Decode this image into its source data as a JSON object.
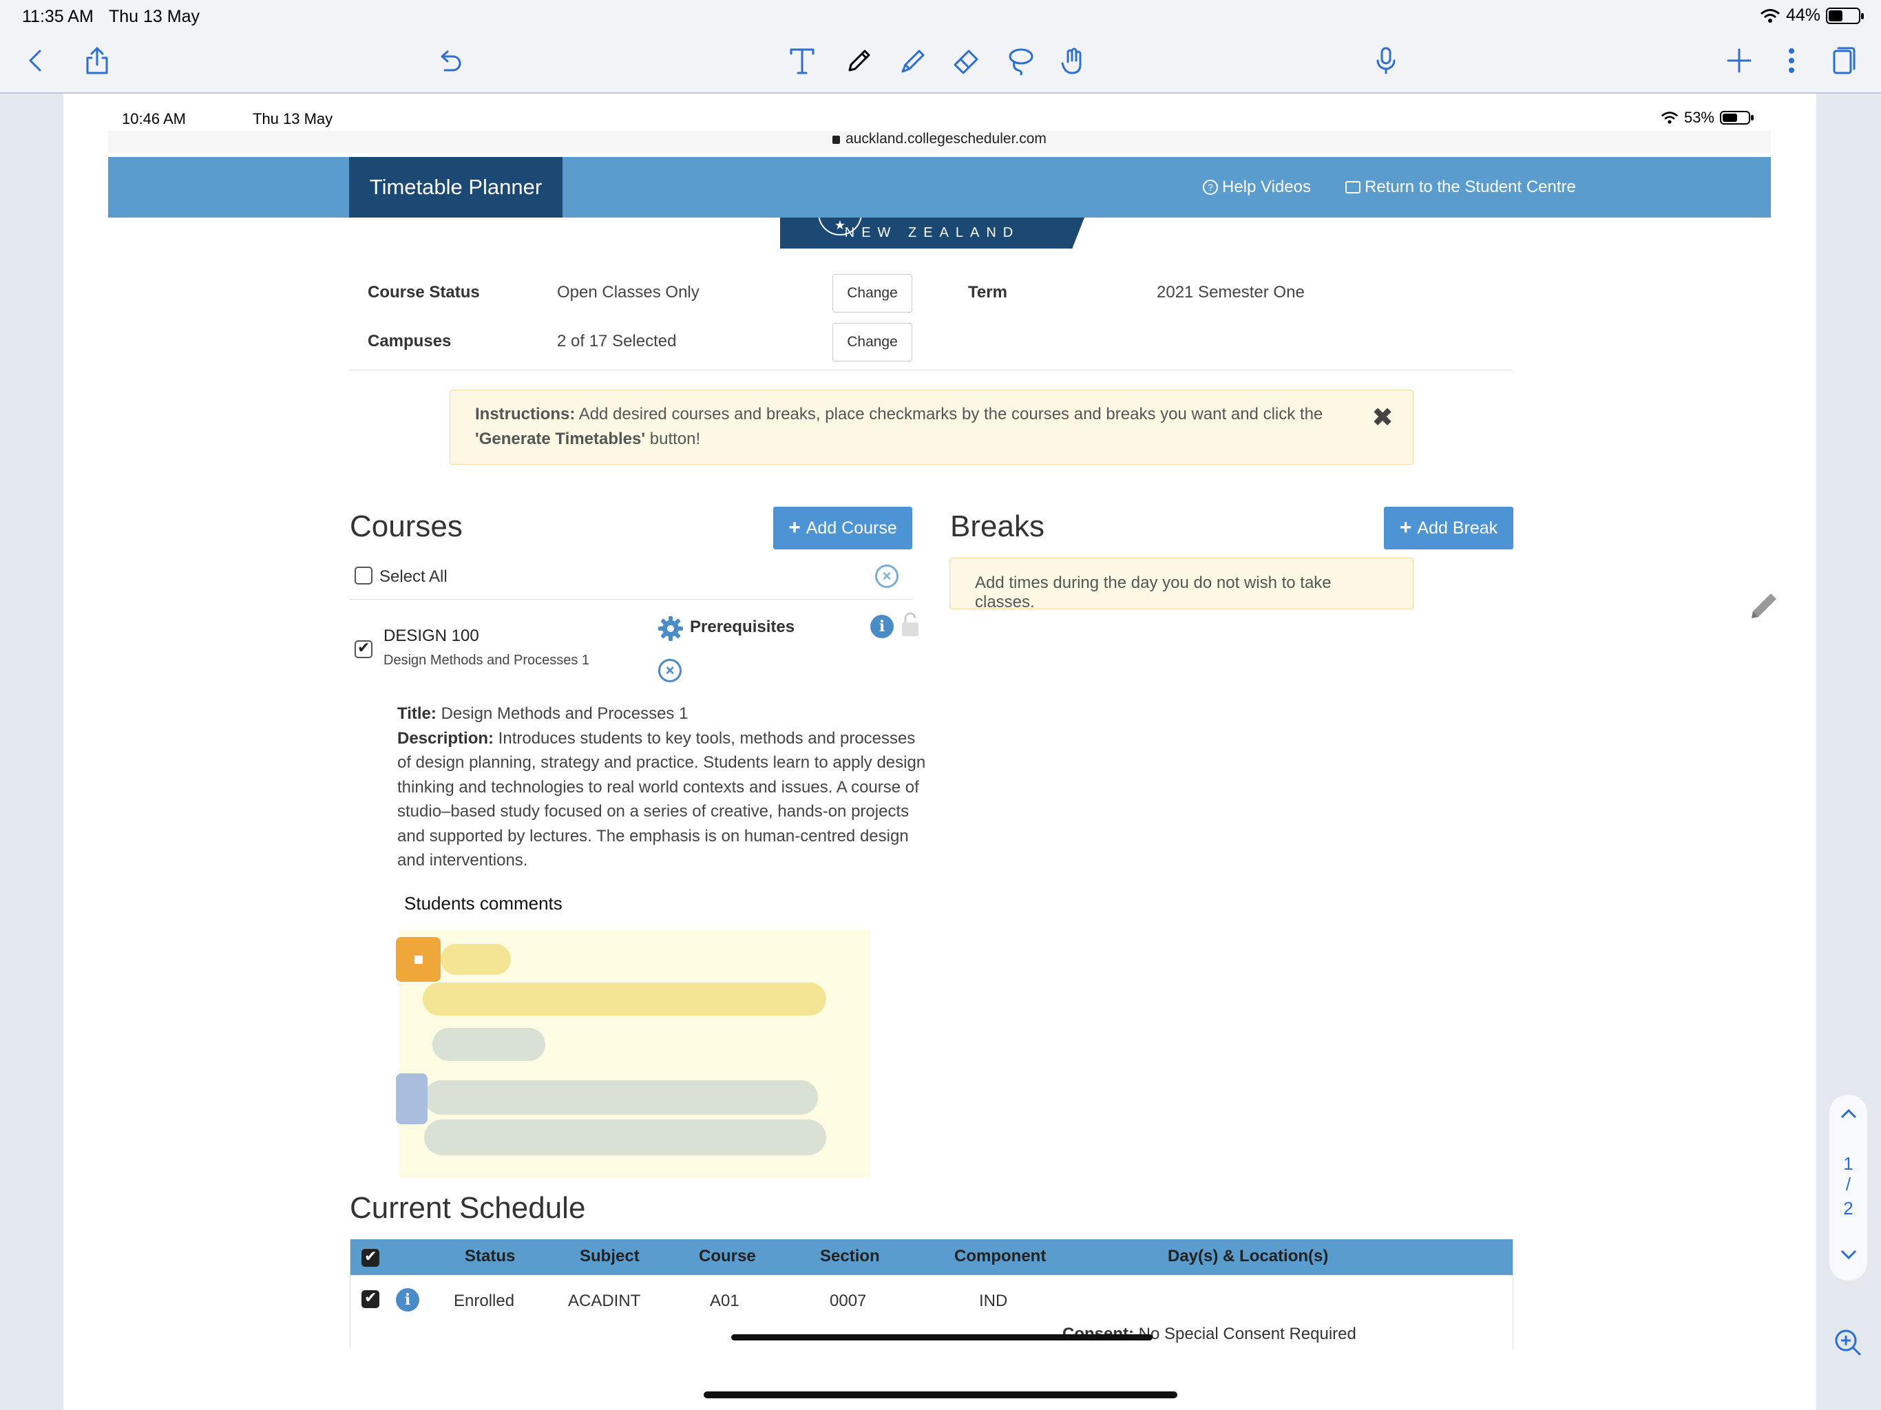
{
  "outer_status": {
    "time": "11:35 AM",
    "date": "Thu 13 May",
    "battery": "44%",
    "battery_level": 0.44
  },
  "toolbar_icons": [
    "back-icon",
    "share-icon",
    "undo-icon",
    "text-tool-icon",
    "pen-icon",
    "highlighter-icon",
    "eraser-icon",
    "lasso-icon",
    "hand-icon",
    "microphone-icon",
    "add-icon",
    "more-icon",
    "pages-icon"
  ],
  "inner_status": {
    "time": "10:46 AM",
    "date": "Thu 13 May",
    "battery": "53%",
    "battery_level": 0.53
  },
  "url": "auckland.collegescheduler.com",
  "navbar": {
    "brand": "Timetable Planner",
    "help": "Help Videos",
    "return": "Return to the Student Centre"
  },
  "logo_text": "NEW ZEALAND",
  "filters": {
    "course_status_label": "Course Status",
    "course_status_value": "Open Classes Only",
    "campuses_label": "Campuses",
    "campuses_value": "2 of 17 Selected",
    "change_label": "Change",
    "term_label": "Term",
    "term_value": "2021 Semester One"
  },
  "instructions": {
    "lead": "Instructions:",
    "text1": " Add desired courses and breaks, place checkmarks by the courses and breaks you want and click the ",
    "quoted": "'Generate Timetables'",
    "text2": " button!"
  },
  "courses": {
    "heading": "Courses",
    "add_button": "Add Course",
    "select_all": "Select All",
    "item": {
      "code": "DESIGN 100",
      "name": "Design Methods and Processes 1",
      "prereq": "Prerequisites",
      "title_label": "Title:",
      "title": " Design Methods and Processes 1",
      "desc_label": "Description:",
      "description": " Introduces students to key tools, methods and processes of design planning, strategy and practice. Students learn to apply design thinking and technologies to real world contexts and issues. A course of studio–based study focused on a series of creative, hands-on projects and supported by lectures. The emphasis is on human-centred design and interventions."
    }
  },
  "breaks": {
    "heading": "Breaks",
    "add_button": "Add Break",
    "note": "Add times during the day you do not wish to take classes."
  },
  "comments_label": "Students comments",
  "schedule": {
    "heading": "Current Schedule",
    "columns": [
      "Status",
      "Subject",
      "Course",
      "Section",
      "Component",
      "Day(s) & Location(s)"
    ],
    "rows": [
      {
        "status": "Enrolled",
        "subject": "ACADINT",
        "course": "A01",
        "section": "0007",
        "component": "IND",
        "consent_label": "Consent:",
        "consent": " No Special Consent Required"
      }
    ]
  },
  "page_nav": {
    "current": "1",
    "sep": "/",
    "total": "2"
  }
}
